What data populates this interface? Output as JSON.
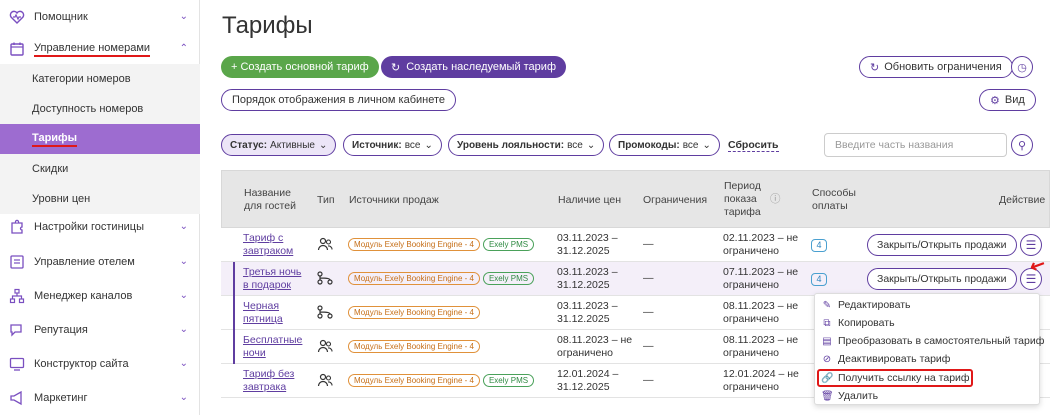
{
  "sidebar": {
    "items": [
      {
        "label": "Помощник",
        "icon": "heart-pulse-icon"
      },
      {
        "label": "Управление номерами",
        "icon": "calendar-icon"
      },
      {
        "label": "Настройки гостиницы",
        "icon": "puzzle-icon"
      },
      {
        "label": "Управление отелем",
        "icon": "checklist-icon"
      },
      {
        "label": "Менеджер каналов",
        "icon": "network-icon"
      },
      {
        "label": "Репутация",
        "icon": "chat-icon"
      },
      {
        "label": "Конструктор сайта",
        "icon": "monitor-icon"
      },
      {
        "label": "Маркетинг",
        "icon": "megaphone-icon"
      }
    ],
    "subitems": [
      {
        "label": "Категории номеров"
      },
      {
        "label": "Доступность номеров"
      },
      {
        "label": "Тарифы"
      },
      {
        "label": "Скидки"
      },
      {
        "label": "Уровни цен"
      }
    ]
  },
  "page": {
    "title": "Тарифы",
    "btn_create_main": "+ Создать основной тариф",
    "btn_create_inherited": "Создать наследуемый тариф",
    "btn_update_limits": "Обновить ограничения",
    "btn_display_order": "Порядок отображения в личном кабинете",
    "btn_view": "Вид"
  },
  "filters": {
    "status_label": "Статус:",
    "status_value": "Активные",
    "source_label": "Источник:",
    "source_value": "все",
    "loyalty_label": "Уровень лояльности:",
    "loyalty_value": "все",
    "promo_label": "Промокоды:",
    "promo_value": "все",
    "reset": "Сбросить",
    "search_placeholder": "Введите часть названия"
  },
  "table": {
    "headers": {
      "name": "Название для гостей",
      "type": "Тип",
      "sources": "Источники продаж",
      "prices": "Наличие цен",
      "limits": "Ограничения",
      "period": "Период показа тарифа",
      "payment": "Способы оплаты",
      "action": "Действие"
    },
    "rows": [
      {
        "name": "Тариф с завтраком",
        "type": "people-icon",
        "src1": "Модуль Exely Booking Engine - 4",
        "src2": "Exely PMS",
        "prices": "03.11.2023 – 31.12.2025",
        "limits": "—",
        "period": "02.11.2023 – не ограничено",
        "payment": "4",
        "action": "Закрыть/Открыть продажи"
      },
      {
        "name": "Третья ночь в подарок",
        "type": "branch-icon",
        "src1": "Модуль Exely Booking Engine - 4",
        "src2": "Exely PMS",
        "prices": "03.11.2023 – 31.12.2025",
        "limits": "—",
        "period": "07.11.2023 – не ограничено",
        "payment": "4",
        "action": "Закрыть/Открыть продажи"
      },
      {
        "name": "Черная пятница",
        "type": "branch-icon",
        "src1": "Модуль Exely Booking Engine - 4",
        "src2": "",
        "prices": "03.11.2023 – 31.12.2025",
        "limits": "—",
        "period": "08.11.2023 – не ограничено",
        "payment": "",
        "action": ""
      },
      {
        "name": "Бесплатные ночи",
        "type": "people-icon",
        "src1": "Модуль Exely Booking Engine - 4",
        "src2": "",
        "prices": "08.11.2023 – не ограничено",
        "limits": "—",
        "period": "08.11.2023 – не ограничено",
        "payment": "",
        "action": ""
      },
      {
        "name": "Тариф без завтрака",
        "type": "people-icon",
        "src1": "Модуль Exely Booking Engine - 4",
        "src2": "Exely PMS",
        "prices": "12.01.2024 – 31.12.2025",
        "limits": "—",
        "period": "12.01.2024 – не ограничено",
        "payment": "",
        "action": ""
      }
    ]
  },
  "dropdown": {
    "items": [
      {
        "label": "Редактировать",
        "icon": "pencil-icon"
      },
      {
        "label": "Копировать",
        "icon": "copy-icon"
      },
      {
        "label": "Преобразовать в самостоятельный тариф",
        "icon": "convert-icon"
      },
      {
        "label": "Деактивировать тариф",
        "icon": "deactivate-icon"
      },
      {
        "label": "Получить ссылку на тариф",
        "icon": "link-icon"
      },
      {
        "label": "Удалить",
        "icon": "trash-icon"
      }
    ]
  },
  "colors": {
    "accent": "#5f3da0",
    "active_sidebar": "#9d6cd0",
    "green": "#5aa64a",
    "highlight_red": "#e01818"
  }
}
